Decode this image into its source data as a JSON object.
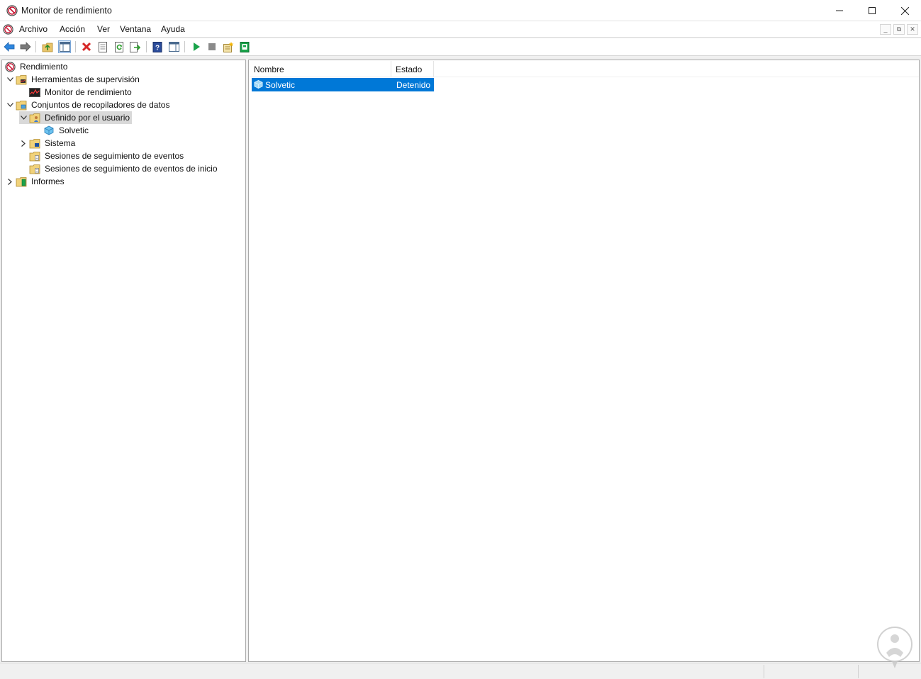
{
  "window": {
    "title": "Monitor de rendimiento",
    "controls": {
      "minimize": "minimize",
      "maximize": "maximize",
      "close": "close"
    }
  },
  "menubar": {
    "items": [
      {
        "label": "Archivo"
      },
      {
        "label": "Acción"
      },
      {
        "label": "Ver"
      },
      {
        "label": "Ventana"
      },
      {
        "label": "Ayuda"
      }
    ]
  },
  "toolbar": {
    "buttons": [
      {
        "name": "back",
        "icon": "back-arrow-icon"
      },
      {
        "name": "forward",
        "icon": "forward-arrow-icon"
      },
      {
        "name": "up-level",
        "icon": "folder-up-icon"
      },
      {
        "name": "show-hide-console-tree",
        "icon": "console-tree-icon",
        "pressed": true
      },
      {
        "name": "delete",
        "icon": "delete-x-icon"
      },
      {
        "name": "properties",
        "icon": "properties-icon"
      },
      {
        "name": "refresh",
        "icon": "refresh-icon"
      },
      {
        "name": "export-list",
        "icon": "export-list-icon"
      },
      {
        "name": "help",
        "icon": "help-icon"
      },
      {
        "name": "show-hide-action-pane",
        "icon": "action-pane-icon"
      },
      {
        "name": "start",
        "icon": "play-icon"
      },
      {
        "name": "stop",
        "icon": "stop-icon"
      },
      {
        "name": "new-collector-set",
        "icon": "new-collector-set-icon"
      },
      {
        "name": "latest-report",
        "icon": "report-icon"
      }
    ]
  },
  "tree": {
    "nodes": [
      {
        "label": "Rendimiento",
        "icon": "performance-icon",
        "level": 0,
        "expander": "none"
      },
      {
        "label": "Herramientas de supervisión",
        "icon": "monitoring-tools-folder-icon",
        "level": 1,
        "expander": "expanded"
      },
      {
        "label": "Monitor de rendimiento",
        "icon": "performance-monitor-chart-icon",
        "level": 2,
        "expander": "none"
      },
      {
        "label": "Conjuntos de recopiladores de datos",
        "icon": "data-collector-sets-folder-icon",
        "level": 1,
        "expander": "expanded"
      },
      {
        "label": "Definido por el usuario",
        "icon": "user-defined-folder-icon",
        "level": 2,
        "expander": "expanded",
        "selected": true
      },
      {
        "label": "Solvetic",
        "icon": "collector-set-icon",
        "level": 3,
        "expander": "none"
      },
      {
        "label": "Sistema",
        "icon": "system-folder-icon",
        "level": 2,
        "expander": "collapsed"
      },
      {
        "label": "Sesiones de seguimiento de eventos",
        "icon": "event-trace-folder-icon",
        "level": 2,
        "expander": "none"
      },
      {
        "label": "Sesiones de seguimiento de eventos de inicio",
        "icon": "startup-trace-folder-icon",
        "level": 2,
        "expander": "none"
      },
      {
        "label": "Informes",
        "icon": "reports-folder-icon",
        "level": 1,
        "expander": "collapsed"
      }
    ]
  },
  "list": {
    "columns": [
      "Nombre",
      "Estado"
    ],
    "rows": [
      {
        "name": "Solvetic",
        "status": "Detenido",
        "selected": true,
        "icon": "collector-set-icon"
      }
    ]
  },
  "colors": {
    "selection": "#0078d7",
    "tree_selection": "#d9d9d9",
    "pane_border": "#a9a9a9"
  },
  "watermark": {
    "icon": "solvetic-watermark-icon"
  }
}
